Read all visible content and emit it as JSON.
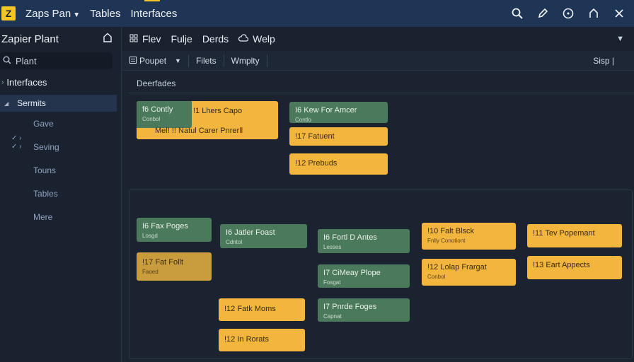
{
  "topbar": {
    "logo": "Z",
    "items": [
      "Zaps Pan",
      "Tables",
      "Interfaces"
    ],
    "icons": [
      "search-icon",
      "pen-icon",
      "help-icon",
      "home-icon",
      "close-icon"
    ]
  },
  "sidebar": {
    "title": "Zapier Plant",
    "search_value": "Plant",
    "section": "Interfaces",
    "selected": "Sermits",
    "items": [
      "Gave",
      "Seving",
      "Touns",
      "Tables",
      "Mere"
    ]
  },
  "toolbar1": {
    "items": [
      "Flev",
      "Fulje",
      "Derds",
      "Welp"
    ],
    "end_icon": "chevron-down-icon"
  },
  "toolbar2": {
    "items": [
      "Poupet",
      "Filets",
      "Wmplty"
    ],
    "end": "Sisp |"
  },
  "section_label": "Deerfades",
  "cards_top": {
    "composite": {
      "title": "f6 Contly",
      "sub": "Conbol",
      "right": "!1 Lhers Capo",
      "bottom": "Mel! !! Natul Carer Pnrerll"
    },
    "col2": [
      {
        "title": "I6  Kew For Amcer",
        "sub": "Contlo"
      },
      {
        "title": "!17 Fatuent"
      },
      {
        "title": "!12 Prebuds"
      }
    ]
  },
  "cards_bottom": {
    "col1": [
      {
        "title": "I6  Fax Poges",
        "sub": "Losgd"
      },
      {
        "title": "!17 Fat Follt",
        "sub": "Faoed"
      }
    ],
    "col2": [
      {
        "title": "I6  Jatler Foast",
        "sub": "Cdntol"
      },
      {
        "title": "!12 Fatk Moms"
      },
      {
        "title": "!12 In Rorats"
      }
    ],
    "col3": [
      {
        "title": "I6  Fortl D Antes",
        "sub": "Lesses"
      },
      {
        "title": "I7  CiMeay Plope",
        "sub": "Fosgat"
      },
      {
        "title": "I7  Pnrde Foges",
        "sub": "Capnat"
      }
    ],
    "col4": [
      {
        "title": "!10 Falt Blsck",
        "sub": "Fnlly Conotiont"
      },
      {
        "title": "!12 Lolap Frargat",
        "sub": "Conbol"
      }
    ],
    "col5": [
      {
        "title": "!11 Tev Popemant"
      },
      {
        "title": "!13 Eart Appects"
      }
    ]
  }
}
